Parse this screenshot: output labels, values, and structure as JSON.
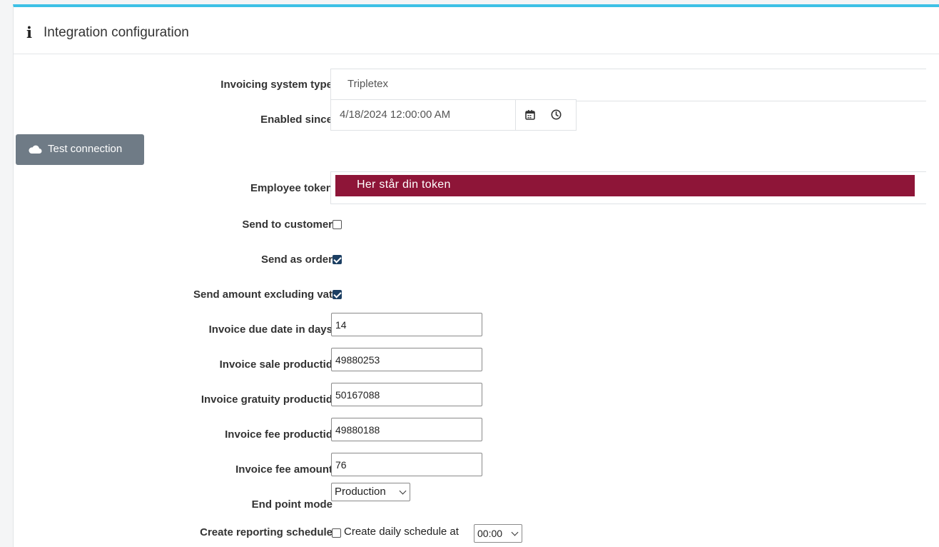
{
  "panel": {
    "title": "Integration configuration",
    "accent_color": "#3ec1e6"
  },
  "form": {
    "invoicing_system_type": {
      "label": "Invoicing system type",
      "value": "Tripletex"
    },
    "enabled_since": {
      "label": "Enabled since",
      "value": "4/18/2024 12:00:00 AM"
    },
    "test_connection": {
      "label": "Test connection"
    },
    "employee_token": {
      "label": "Employee token",
      "value": "Her står din token",
      "banner_color": "#8e1538"
    },
    "send_to_customer": {
      "label": "Send to customer",
      "checked": false
    },
    "send_as_order": {
      "label": "Send as order",
      "checked": true
    },
    "send_amount_excluding_vat": {
      "label": "Send amount excluding vat",
      "checked": true
    },
    "invoice_due_date_in_days": {
      "label": "Invoice due date in days",
      "value": "14"
    },
    "invoice_sale_productid": {
      "label": "Invoice sale productid",
      "value": "49880253"
    },
    "invoice_gratuity_productid": {
      "label": "Invoice gratuity productid",
      "value": "50167088"
    },
    "invoice_fee_productid": {
      "label": "Invoice fee productid",
      "value": "49880188"
    },
    "invoice_fee_amount": {
      "label": "Invoice fee amount",
      "value": "76"
    },
    "end_point_mode": {
      "label": "End point mode",
      "value": "Production"
    },
    "create_reporting_schedule": {
      "label": "Create reporting schedule",
      "checked": false,
      "checkbox_text": "Create daily schedule at",
      "time": "00:00"
    }
  },
  "icons": {
    "info": "info-icon",
    "calendar": "calendar-icon",
    "clock": "clock-icon",
    "cloud": "cloud-icon",
    "chevron": "chevron-down-icon"
  }
}
